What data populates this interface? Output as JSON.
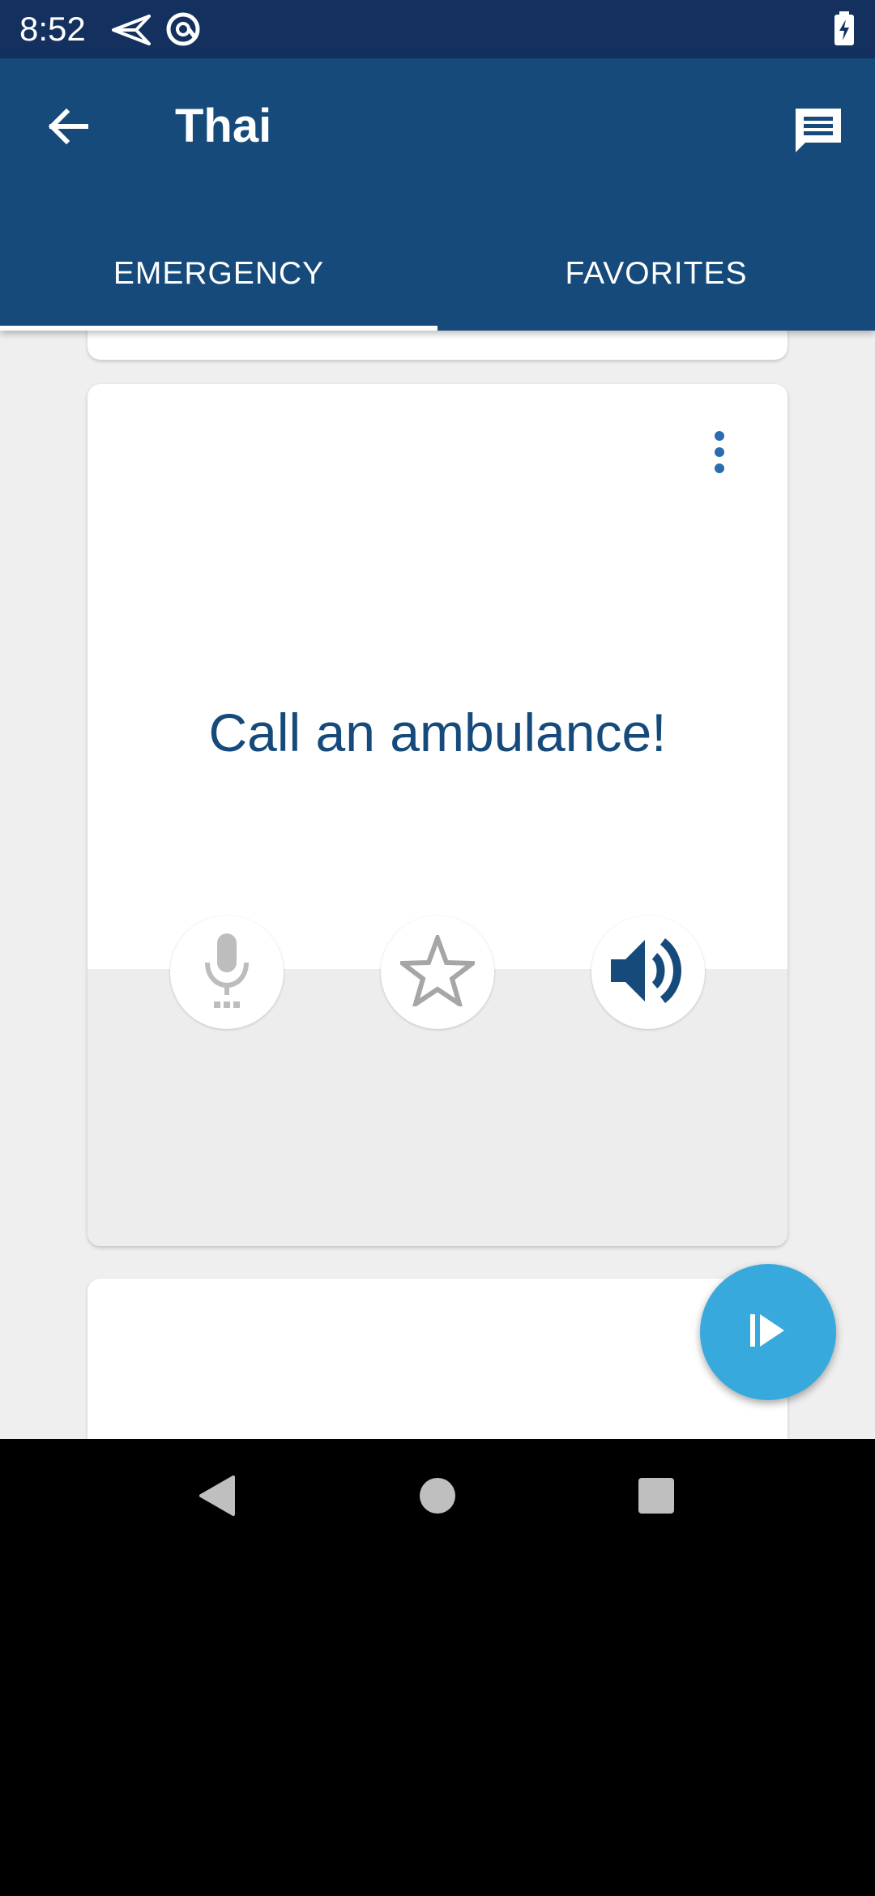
{
  "status_bar": {
    "time": "8:52",
    "icons": [
      "send-icon",
      "at-sign-icon",
      "battery-charging-icon"
    ]
  },
  "app_bar": {
    "title": "Thai",
    "back_icon": "arrow-left-icon",
    "action_icon": "chat-icon"
  },
  "tabs": [
    {
      "label": "EMERGENCY",
      "selected": true
    },
    {
      "label": "FAVORITES",
      "selected": false
    }
  ],
  "phrase_card": {
    "text": "Call an ambulance!",
    "menu_icon": "more-vert-icon",
    "actions": [
      "microphone-icon",
      "star-outline-icon",
      "volume-up-icon"
    ]
  },
  "fab": {
    "icon": "play-icon"
  },
  "nav_bar": {
    "icons": [
      "nav-back-icon",
      "nav-home-icon",
      "nav-recents-icon"
    ]
  },
  "colors": {
    "status_bar": "#13305e",
    "app_bar": "#154a7a",
    "accent": "#38a9dc",
    "phrase_text": "#154a7a",
    "background": "#efefef"
  }
}
